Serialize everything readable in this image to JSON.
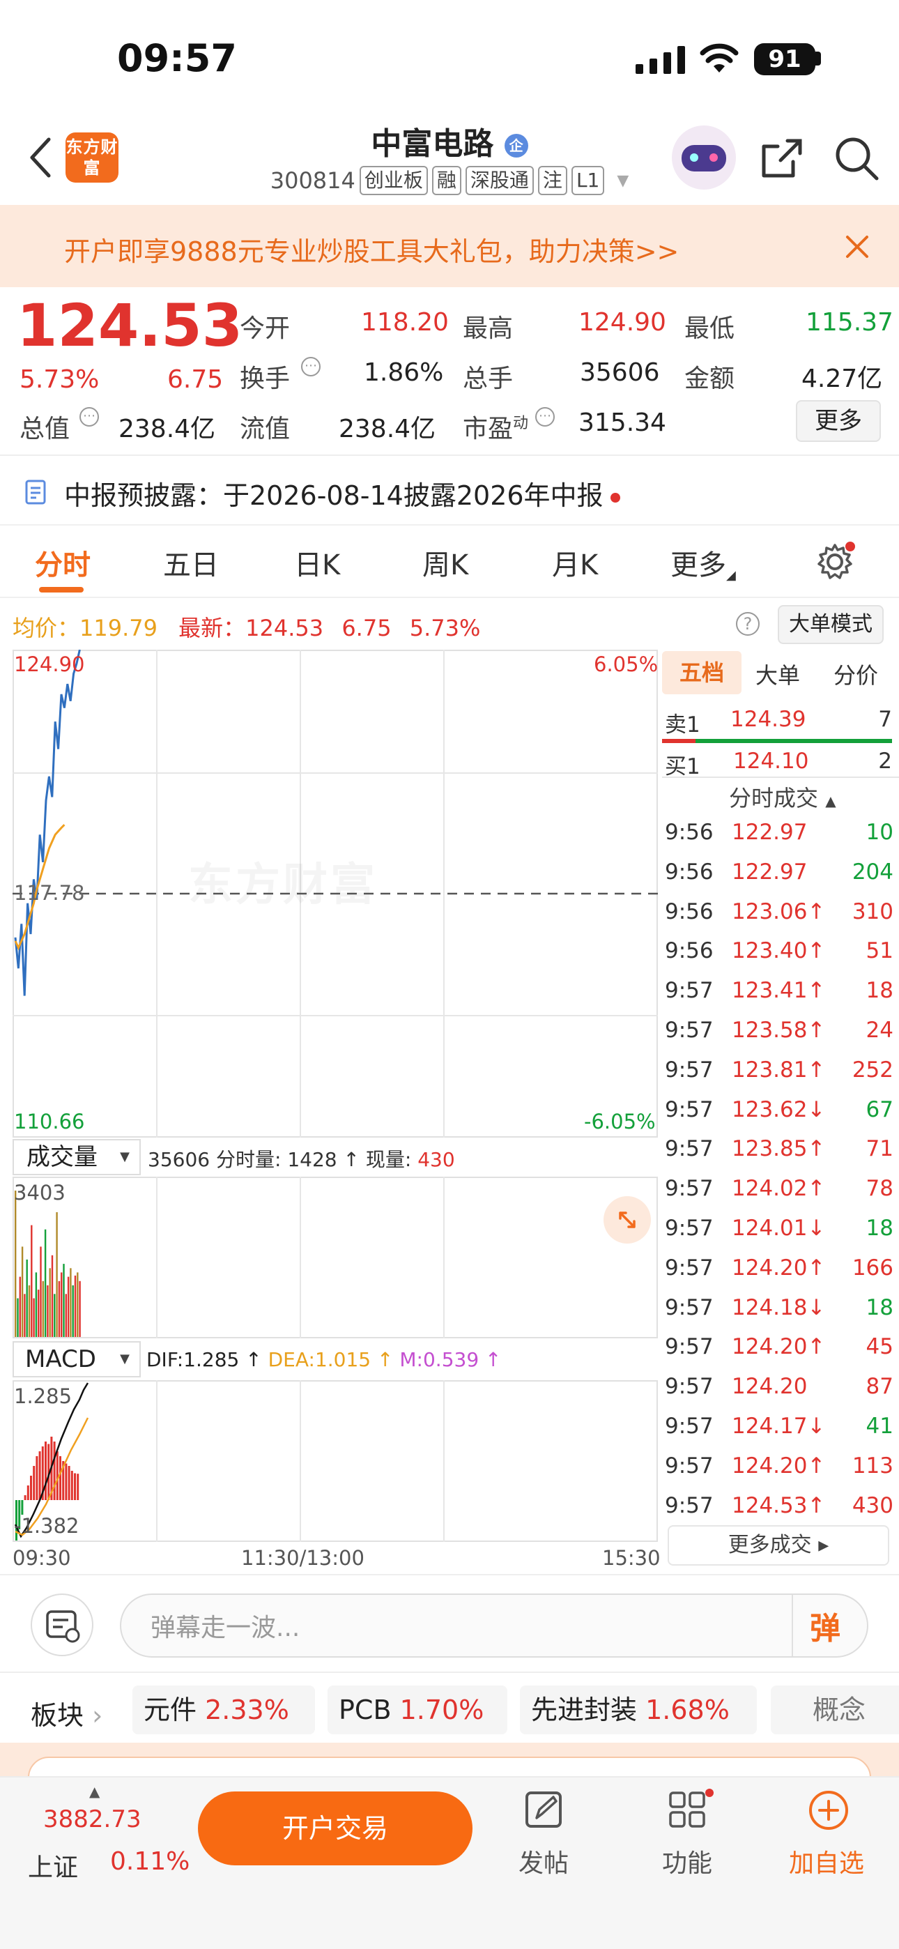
{
  "status_bar": {
    "time": "09:57",
    "battery": "91"
  },
  "header": {
    "logo_text": "东方财富",
    "stock_name": "中富电路",
    "stock_badge": "企",
    "stock_code": "300814",
    "tags": [
      "创业板",
      "融",
      "深股通",
      "注",
      "L1"
    ]
  },
  "banner": {
    "text": "开户即享9888元专业炒股工具大礼包，助力决策>>"
  },
  "quote": {
    "price": "124.53",
    "change_pct": "5.73%",
    "change_amt": "6.75",
    "open_label": "今开",
    "open": "118.20",
    "high_label": "最高",
    "high": "124.90",
    "low_label": "最低",
    "low": "115.37",
    "turnover_label": "换手",
    "turnover": "1.86%",
    "volume_label": "总手",
    "volume": "35606",
    "amount_label": "金额",
    "amount": "4.27亿",
    "mktcap_label": "总值",
    "mktcap": "238.4亿",
    "float_label": "流值",
    "float": "238.4亿",
    "pe_label": "市盈",
    "pe_sup": "动",
    "pe": "315.34",
    "more_button": "更多"
  },
  "notice": {
    "text": "中报预披露：于2026-08-14披露2026年中报"
  },
  "tabs": [
    "分时",
    "五日",
    "日K",
    "周K",
    "月K",
    "更多"
  ],
  "chart_header": {
    "avg_label": "均价：",
    "avg_value": "119.79",
    "latest_label": "最新：",
    "latest_value": "124.53",
    "latest_change": "6.75",
    "latest_pct": "5.73%",
    "mode_button": "大单模式"
  },
  "chart_labels": {
    "price_top": "124.90",
    "price_mid": "117.78",
    "price_bottom": "110.66",
    "pct_top": "6.05%",
    "pct_bottom": "-6.05%",
    "watermark": "东方财富",
    "vol_selector": "成交量",
    "vol_total": "35606",
    "vol_period_label": "分时量:",
    "vol_period": "1428",
    "vol_now_label": "现量:",
    "vol_now": "430",
    "vol_max": "3403",
    "macd_selector": "MACD",
    "dif": "DIF:1.285",
    "dea": "DEA:1.015",
    "m": "M:0.539",
    "macd_top": "1.285",
    "macd_bottom": "-1.382",
    "time_start": "09:30",
    "time_mid": "11:30/13:00",
    "time_end": "15:30"
  },
  "chart_data": {
    "type": "line",
    "series": [
      {
        "name": "price",
        "values": [
          116.5,
          115.6,
          116.9,
          114.8,
          117.5,
          116.6,
          118.2,
          117.6,
          119.5,
          118.7,
          120.5,
          121.2,
          120.6,
          122.8,
          122.0,
          123.6,
          123.2,
          123.9,
          123.4,
          124.2,
          124.5,
          124.9
        ]
      },
      {
        "name": "avg",
        "values": [
          116.4,
          116.2,
          116.4,
          116.6,
          116.9,
          117.2,
          117.5,
          117.9,
          118.2,
          118.5,
          118.8,
          119.1,
          119.3,
          119.5,
          119.6,
          119.7,
          119.79
        ]
      }
    ],
    "ylim": [
      110.66,
      124.9
    ],
    "volume_bars": [
      3403,
      900,
      1400,
      2100,
      1000,
      1800,
      1200,
      2600,
      900,
      1500,
      1100,
      2100,
      1300,
      2500,
      1200,
      1600,
      1900,
      1000,
      2900,
      1300,
      1500,
      1700,
      1000,
      1400,
      1600,
      1200,
      1428,
      1500,
      1300
    ],
    "macd_bars": [
      -0.9,
      -0.6,
      -0.3,
      0.1,
      0.3,
      0.5,
      0.7,
      0.9,
      1.0,
      1.1,
      1.2,
      1.15,
      1.3,
      1.2,
      1.0,
      0.9,
      0.8,
      0.75,
      0.7,
      0.6,
      0.55,
      0.54
    ]
  },
  "order_book": {
    "tabs": [
      "五档",
      "大单",
      "分价"
    ],
    "sell": {
      "label": "卖1",
      "price": "124.39",
      "qty": "7"
    },
    "buy": {
      "label": "买1",
      "price": "124.10",
      "qty": "2"
    },
    "trades_header": "分时成交",
    "trades": [
      {
        "t": "9:56",
        "p": "122.97",
        "q": "10",
        "pc": "red",
        "qc": "green"
      },
      {
        "t": "9:56",
        "p": "122.97",
        "q": "204",
        "pc": "red",
        "qc": "green"
      },
      {
        "t": "9:56",
        "p": "123.06↑",
        "q": "310",
        "pc": "red",
        "qc": "red"
      },
      {
        "t": "9:56",
        "p": "123.40↑",
        "q": "51",
        "pc": "red",
        "qc": "red"
      },
      {
        "t": "9:57",
        "p": "123.41↑",
        "q": "18",
        "pc": "red",
        "qc": "red"
      },
      {
        "t": "9:57",
        "p": "123.58↑",
        "q": "24",
        "pc": "red",
        "qc": "red"
      },
      {
        "t": "9:57",
        "p": "123.81↑",
        "q": "252",
        "pc": "red",
        "qc": "red"
      },
      {
        "t": "9:57",
        "p": "123.62↓",
        "q": "67",
        "pc": "red",
        "qc": "green"
      },
      {
        "t": "9:57",
        "p": "123.85↑",
        "q": "71",
        "pc": "red",
        "qc": "red"
      },
      {
        "t": "9:57",
        "p": "124.02↑",
        "q": "78",
        "pc": "red",
        "qc": "red"
      },
      {
        "t": "9:57",
        "p": "124.01↓",
        "q": "18",
        "pc": "red",
        "qc": "green"
      },
      {
        "t": "9:57",
        "p": "124.20↑",
        "q": "166",
        "pc": "red",
        "qc": "red"
      },
      {
        "t": "9:57",
        "p": "124.18↓",
        "q": "18",
        "pc": "red",
        "qc": "green"
      },
      {
        "t": "9:57",
        "p": "124.20↑",
        "q": "45",
        "pc": "red",
        "qc": "red"
      },
      {
        "t": "9:57",
        "p": "124.20",
        "q": "87",
        "pc": "red",
        "qc": "red"
      },
      {
        "t": "9:57",
        "p": "124.17↓",
        "q": "41",
        "pc": "red",
        "qc": "green"
      },
      {
        "t": "9:57",
        "p": "124.20↑",
        "q": "113",
        "pc": "red",
        "qc": "red"
      },
      {
        "t": "9:57",
        "p": "124.53↑",
        "q": "430",
        "pc": "red",
        "qc": "red"
      }
    ],
    "more_trades": "更多成交"
  },
  "comment": {
    "placeholder": "弹幕走一波...",
    "danmu_button": "弹"
  },
  "sectors": {
    "label": "板块",
    "items": [
      {
        "name": "元件",
        "pct": "2.33%"
      },
      {
        "name": "PCB",
        "pct": "1.70%"
      },
      {
        "name": "先进封装",
        "pct": "1.68%"
      }
    ],
    "overflow": "概念"
  },
  "bottom_nav": {
    "index_value": "3882.73",
    "index_name": "上证",
    "index_pct": "0.11%",
    "trade_button": "开户交易",
    "post": "发帖",
    "features": "功能",
    "add_watch": "加自选"
  },
  "colors": {
    "up": "#e0332e",
    "down": "#13a03a",
    "accent": "#f26b1d",
    "price_line": "#2f6fbf",
    "avg_line": "#f0a020"
  }
}
